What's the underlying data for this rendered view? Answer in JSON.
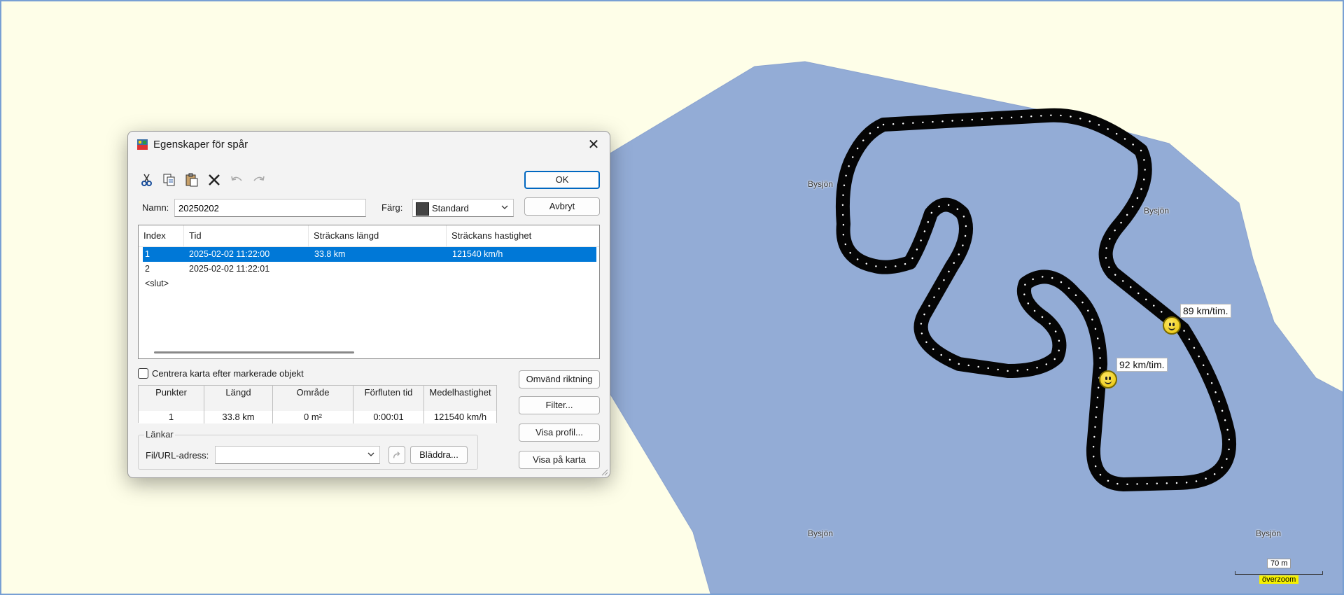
{
  "map": {
    "water_color": "#93acd6",
    "land_color": "#fefee8",
    "labels": [
      "Bysjön",
      "Bysjön",
      "Bysjön",
      "Bysjön"
    ],
    "speed_labels": [
      "89 km/tim.",
      "92 km/tim."
    ],
    "scale": "70 m",
    "overzoom": "överzoom"
  },
  "dialog": {
    "title": "Egenskaper för spår",
    "close": "✕",
    "toolbar": {
      "cut": "cut-icon",
      "copy": "copy-icon",
      "paste": "paste-icon",
      "delete": "delete-icon",
      "undo": "undo-icon",
      "redo": "redo-icon"
    },
    "name_label": "Namn:",
    "name_value": "20250202",
    "color_label": "Färg:",
    "color_value": "Standard",
    "ok_label": "OK",
    "cancel_label": "Avbryt",
    "list": {
      "columns": [
        "Index",
        "Tid",
        "Sträckans längd",
        "Sträckans hastighet"
      ],
      "rows": [
        {
          "index": "1",
          "time": "2025-02-02 11:22:00",
          "length": "33.8 km",
          "speed": "121540 km/h",
          "selected": true
        },
        {
          "index": "2",
          "time": "2025-02-02 11:22:01",
          "length": "",
          "speed": "",
          "selected": false
        },
        {
          "index": "<slut>",
          "time": "",
          "length": "",
          "speed": "",
          "selected": false
        }
      ]
    },
    "center_map_label": "Centrera karta efter markerade objekt",
    "stats": {
      "headers": [
        "Punkter",
        "Längd",
        "Område",
        "Förfluten tid",
        "Medelhastighet"
      ],
      "values": [
        "1",
        "33.8 km",
        "0 m²",
        "0:00:01",
        "121540 km/h"
      ]
    },
    "links_title": "Länkar",
    "file_url_label": "Fil/URL-adress:",
    "browse_label": "Bläddra...",
    "reverse_label": "Omvänd riktning",
    "filter_label": "Filter...",
    "profile_label": "Visa profil...",
    "show_on_map_label": "Visa på karta"
  }
}
